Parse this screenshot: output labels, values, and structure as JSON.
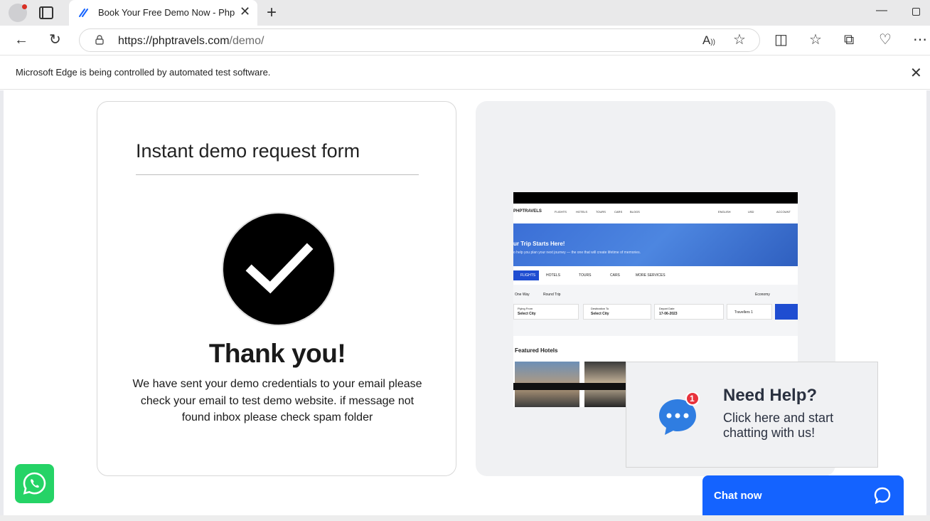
{
  "browser": {
    "tab_title": "Book Your Free Demo Now - Php",
    "url_host": "https://phptravels.com",
    "url_path": "/demo/",
    "infobar_text": "Microsoft Edge is being controlled by automated test software."
  },
  "form": {
    "title": "Instant demo request form",
    "thank_you": "Thank you!",
    "message": "We have sent your demo credentials to your email please check your email to test demo website. if message not found inbox please check spam folder"
  },
  "preview": {
    "logo": "PHPTRAVELS",
    "nav": [
      "FLIGHTS",
      "HOTELS",
      "TOURS",
      "CARS",
      "BLOGS"
    ],
    "language": "ENGLISH",
    "currency": "USD",
    "account": "ACCOUNT",
    "hero_title": "ur Trip Starts Here!",
    "hero_sub": "o help you plan your next journey — the one that will create lifetime of memories.",
    "tabs": [
      "FLIGHTS",
      "HOTELS",
      "TOURS",
      "CARS",
      "MORE SERVICES"
    ],
    "trip_options": [
      "One Way",
      "Round Trip"
    ],
    "cabin": "Economy",
    "flying_from_label": "Flying From",
    "flying_from_value": "Select City",
    "destination_label": "Destination To",
    "destination_value": "Select City",
    "depart_label": "Depart Date",
    "depart_value": "17-06-2023",
    "travellers": "Travellers 1",
    "featured": "Featured Hotels"
  },
  "help": {
    "badge": "1",
    "title": "Need Help?",
    "subtitle": "Click here and start chatting with us!"
  },
  "chat": {
    "label": "Chat now"
  },
  "colors": {
    "chat_blue": "#1463ff",
    "whatsapp_green": "#25d366",
    "help_badge_red": "#e8323c",
    "help_bubble_blue": "#2f7de1"
  }
}
